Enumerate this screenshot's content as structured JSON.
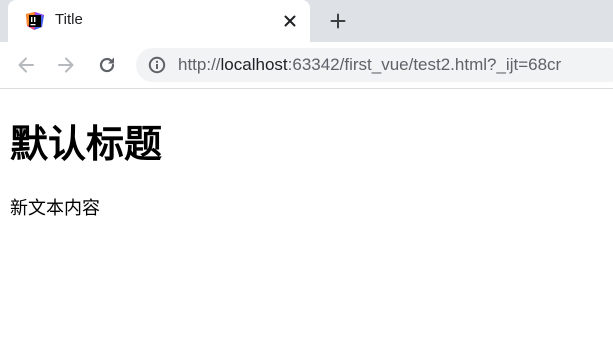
{
  "tab": {
    "title": "Title",
    "favicon": "jetbrains-ide-icon"
  },
  "toolbar": {
    "url_scheme": "http://",
    "url_host": "localhost",
    "url_rest": ":63342/first_vue/test2.html?_ijt=68cr",
    "info_icon": "info-icon"
  },
  "page": {
    "heading": "默认标题",
    "text": "新文本内容"
  },
  "colors": {
    "tabstrip": "#dee1e6",
    "omnibox": "#f1f3f4",
    "icon": "#5f6368"
  }
}
